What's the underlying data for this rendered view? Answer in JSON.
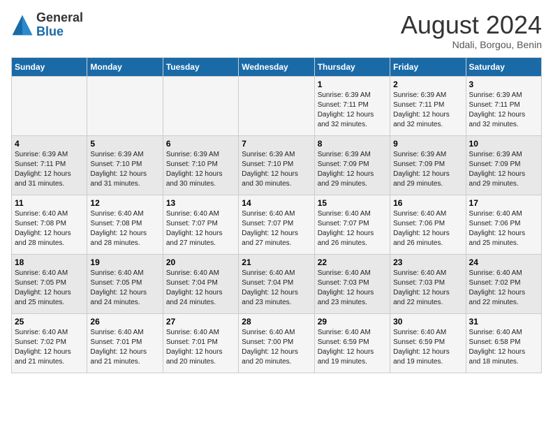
{
  "header": {
    "logo_general": "General",
    "logo_blue": "Blue",
    "main_title": "August 2024",
    "subtitle": "Ndali, Borgou, Benin"
  },
  "calendar": {
    "days_of_week": [
      "Sunday",
      "Monday",
      "Tuesday",
      "Wednesday",
      "Thursday",
      "Friday",
      "Saturday"
    ],
    "weeks": [
      [
        {
          "day": "",
          "info": ""
        },
        {
          "day": "",
          "info": ""
        },
        {
          "day": "",
          "info": ""
        },
        {
          "day": "",
          "info": ""
        },
        {
          "day": "1",
          "info": "Sunrise: 6:39 AM\nSunset: 7:11 PM\nDaylight: 12 hours\nand 32 minutes."
        },
        {
          "day": "2",
          "info": "Sunrise: 6:39 AM\nSunset: 7:11 PM\nDaylight: 12 hours\nand 32 minutes."
        },
        {
          "day": "3",
          "info": "Sunrise: 6:39 AM\nSunset: 7:11 PM\nDaylight: 12 hours\nand 32 minutes."
        }
      ],
      [
        {
          "day": "4",
          "info": "Sunrise: 6:39 AM\nSunset: 7:11 PM\nDaylight: 12 hours\nand 31 minutes."
        },
        {
          "day": "5",
          "info": "Sunrise: 6:39 AM\nSunset: 7:10 PM\nDaylight: 12 hours\nand 31 minutes."
        },
        {
          "day": "6",
          "info": "Sunrise: 6:39 AM\nSunset: 7:10 PM\nDaylight: 12 hours\nand 30 minutes."
        },
        {
          "day": "7",
          "info": "Sunrise: 6:39 AM\nSunset: 7:10 PM\nDaylight: 12 hours\nand 30 minutes."
        },
        {
          "day": "8",
          "info": "Sunrise: 6:39 AM\nSunset: 7:09 PM\nDaylight: 12 hours\nand 29 minutes."
        },
        {
          "day": "9",
          "info": "Sunrise: 6:39 AM\nSunset: 7:09 PM\nDaylight: 12 hours\nand 29 minutes."
        },
        {
          "day": "10",
          "info": "Sunrise: 6:39 AM\nSunset: 7:09 PM\nDaylight: 12 hours\nand 29 minutes."
        }
      ],
      [
        {
          "day": "11",
          "info": "Sunrise: 6:40 AM\nSunset: 7:08 PM\nDaylight: 12 hours\nand 28 minutes."
        },
        {
          "day": "12",
          "info": "Sunrise: 6:40 AM\nSunset: 7:08 PM\nDaylight: 12 hours\nand 28 minutes."
        },
        {
          "day": "13",
          "info": "Sunrise: 6:40 AM\nSunset: 7:07 PM\nDaylight: 12 hours\nand 27 minutes."
        },
        {
          "day": "14",
          "info": "Sunrise: 6:40 AM\nSunset: 7:07 PM\nDaylight: 12 hours\nand 27 minutes."
        },
        {
          "day": "15",
          "info": "Sunrise: 6:40 AM\nSunset: 7:07 PM\nDaylight: 12 hours\nand 26 minutes."
        },
        {
          "day": "16",
          "info": "Sunrise: 6:40 AM\nSunset: 7:06 PM\nDaylight: 12 hours\nand 26 minutes."
        },
        {
          "day": "17",
          "info": "Sunrise: 6:40 AM\nSunset: 7:06 PM\nDaylight: 12 hours\nand 25 minutes."
        }
      ],
      [
        {
          "day": "18",
          "info": "Sunrise: 6:40 AM\nSunset: 7:05 PM\nDaylight: 12 hours\nand 25 minutes."
        },
        {
          "day": "19",
          "info": "Sunrise: 6:40 AM\nSunset: 7:05 PM\nDaylight: 12 hours\nand 24 minutes."
        },
        {
          "day": "20",
          "info": "Sunrise: 6:40 AM\nSunset: 7:04 PM\nDaylight: 12 hours\nand 24 minutes."
        },
        {
          "day": "21",
          "info": "Sunrise: 6:40 AM\nSunset: 7:04 PM\nDaylight: 12 hours\nand 23 minutes."
        },
        {
          "day": "22",
          "info": "Sunrise: 6:40 AM\nSunset: 7:03 PM\nDaylight: 12 hours\nand 23 minutes."
        },
        {
          "day": "23",
          "info": "Sunrise: 6:40 AM\nSunset: 7:03 PM\nDaylight: 12 hours\nand 22 minutes."
        },
        {
          "day": "24",
          "info": "Sunrise: 6:40 AM\nSunset: 7:02 PM\nDaylight: 12 hours\nand 22 minutes."
        }
      ],
      [
        {
          "day": "25",
          "info": "Sunrise: 6:40 AM\nSunset: 7:02 PM\nDaylight: 12 hours\nand 21 minutes."
        },
        {
          "day": "26",
          "info": "Sunrise: 6:40 AM\nSunset: 7:01 PM\nDaylight: 12 hours\nand 21 minutes."
        },
        {
          "day": "27",
          "info": "Sunrise: 6:40 AM\nSunset: 7:01 PM\nDaylight: 12 hours\nand 20 minutes."
        },
        {
          "day": "28",
          "info": "Sunrise: 6:40 AM\nSunset: 7:00 PM\nDaylight: 12 hours\nand 20 minutes."
        },
        {
          "day": "29",
          "info": "Sunrise: 6:40 AM\nSunset: 6:59 PM\nDaylight: 12 hours\nand 19 minutes."
        },
        {
          "day": "30",
          "info": "Sunrise: 6:40 AM\nSunset: 6:59 PM\nDaylight: 12 hours\nand 19 minutes."
        },
        {
          "day": "31",
          "info": "Sunrise: 6:40 AM\nSunset: 6:58 PM\nDaylight: 12 hours\nand 18 minutes."
        }
      ]
    ]
  }
}
